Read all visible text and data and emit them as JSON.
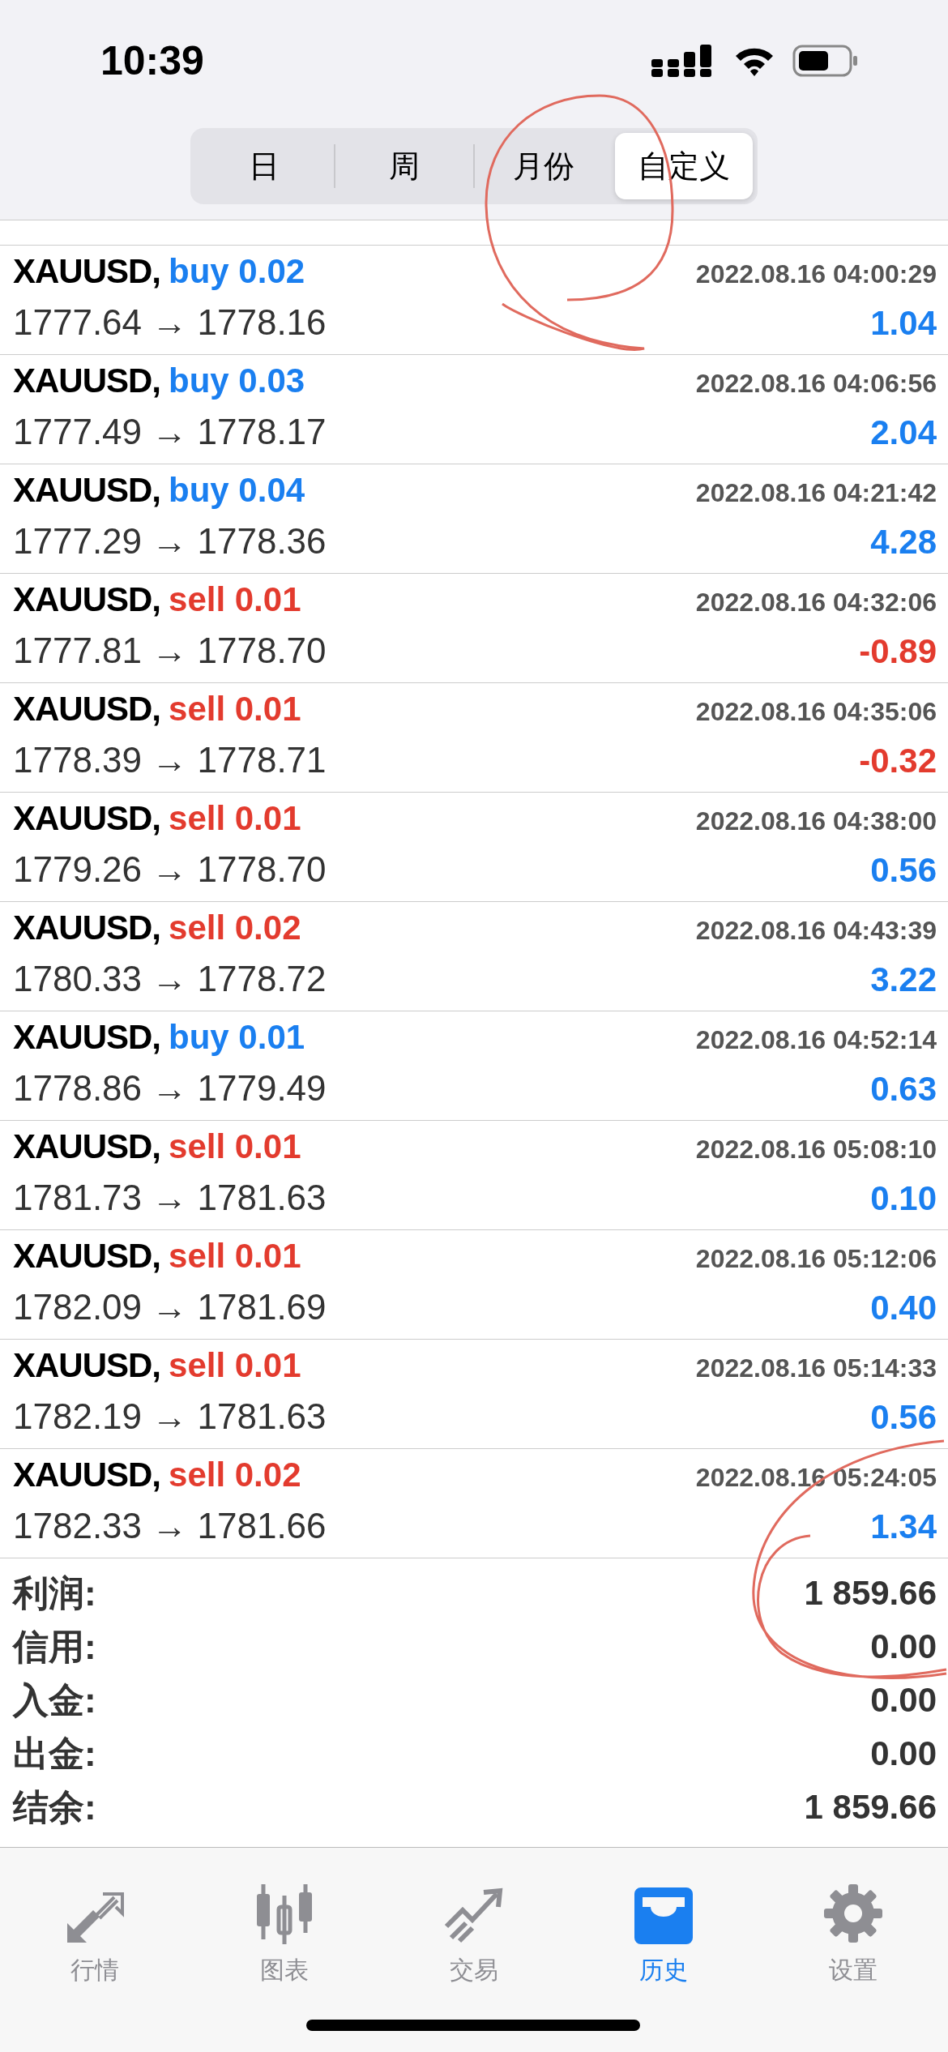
{
  "status_bar": {
    "time": "10:39"
  },
  "period_tabs": [
    {
      "label": "日",
      "selected": false
    },
    {
      "label": "周",
      "selected": false
    },
    {
      "label": "月份",
      "selected": false
    },
    {
      "label": "自定义",
      "selected": true
    }
  ],
  "trades": [
    {
      "symbol": "XAUUSD,",
      "kind": "buy",
      "side": "buy 0.02",
      "time": "2022.08.16 04:00:29",
      "prices": "1777.64 → 1778.16",
      "profit": "1.04",
      "loss": false
    },
    {
      "symbol": "XAUUSD,",
      "kind": "buy",
      "side": "buy 0.03",
      "time": "2022.08.16 04:06:56",
      "prices": "1777.49 → 1778.17",
      "profit": "2.04",
      "loss": false
    },
    {
      "symbol": "XAUUSD,",
      "kind": "buy",
      "side": "buy 0.04",
      "time": "2022.08.16 04:21:42",
      "prices": "1777.29 → 1778.36",
      "profit": "4.28",
      "loss": false
    },
    {
      "symbol": "XAUUSD,",
      "kind": "sell",
      "side": "sell 0.01",
      "time": "2022.08.16 04:32:06",
      "prices": "1777.81 → 1778.70",
      "profit": "-0.89",
      "loss": true
    },
    {
      "symbol": "XAUUSD,",
      "kind": "sell",
      "side": "sell 0.01",
      "time": "2022.08.16 04:35:06",
      "prices": "1778.39 → 1778.71",
      "profit": "-0.32",
      "loss": true
    },
    {
      "symbol": "XAUUSD,",
      "kind": "sell",
      "side": "sell 0.01",
      "time": "2022.08.16 04:38:00",
      "prices": "1779.26 → 1778.70",
      "profit": "0.56",
      "loss": false
    },
    {
      "symbol": "XAUUSD,",
      "kind": "sell",
      "side": "sell 0.02",
      "time": "2022.08.16 04:43:39",
      "prices": "1780.33 → 1778.72",
      "profit": "3.22",
      "loss": false
    },
    {
      "symbol": "XAUUSD,",
      "kind": "buy",
      "side": "buy 0.01",
      "time": "2022.08.16 04:52:14",
      "prices": "1778.86 → 1779.49",
      "profit": "0.63",
      "loss": false
    },
    {
      "symbol": "XAUUSD,",
      "kind": "sell",
      "side": "sell 0.01",
      "time": "2022.08.16 05:08:10",
      "prices": "1781.73 → 1781.63",
      "profit": "0.10",
      "loss": false
    },
    {
      "symbol": "XAUUSD,",
      "kind": "sell",
      "side": "sell 0.01",
      "time": "2022.08.16 05:12:06",
      "prices": "1782.09 → 1781.69",
      "profit": "0.40",
      "loss": false
    },
    {
      "symbol": "XAUUSD,",
      "kind": "sell",
      "side": "sell 0.01",
      "time": "2022.08.16 05:14:33",
      "prices": "1782.19 → 1781.63",
      "profit": "0.56",
      "loss": false
    },
    {
      "symbol": "XAUUSD,",
      "kind": "sell",
      "side": "sell 0.02",
      "time": "2022.08.16 05:24:05",
      "prices": "1782.33 → 1781.66",
      "profit": "1.34",
      "loss": false
    }
  ],
  "summary": [
    {
      "label": "利润:",
      "value": "1 859.66"
    },
    {
      "label": "信用:",
      "value": "0.00"
    },
    {
      "label": "入金:",
      "value": "0.00"
    },
    {
      "label": "出金:",
      "value": "0.00"
    },
    {
      "label": "结余:",
      "value": "1 859.66"
    }
  ],
  "tab_bar": [
    {
      "kind": "quotes",
      "label": "行情",
      "selected": false
    },
    {
      "kind": "chart",
      "label": "图表",
      "selected": false
    },
    {
      "kind": "trade",
      "label": "交易",
      "selected": false
    },
    {
      "kind": "history",
      "label": "历史",
      "selected": true
    },
    {
      "kind": "settings",
      "label": "设置",
      "selected": false
    }
  ]
}
